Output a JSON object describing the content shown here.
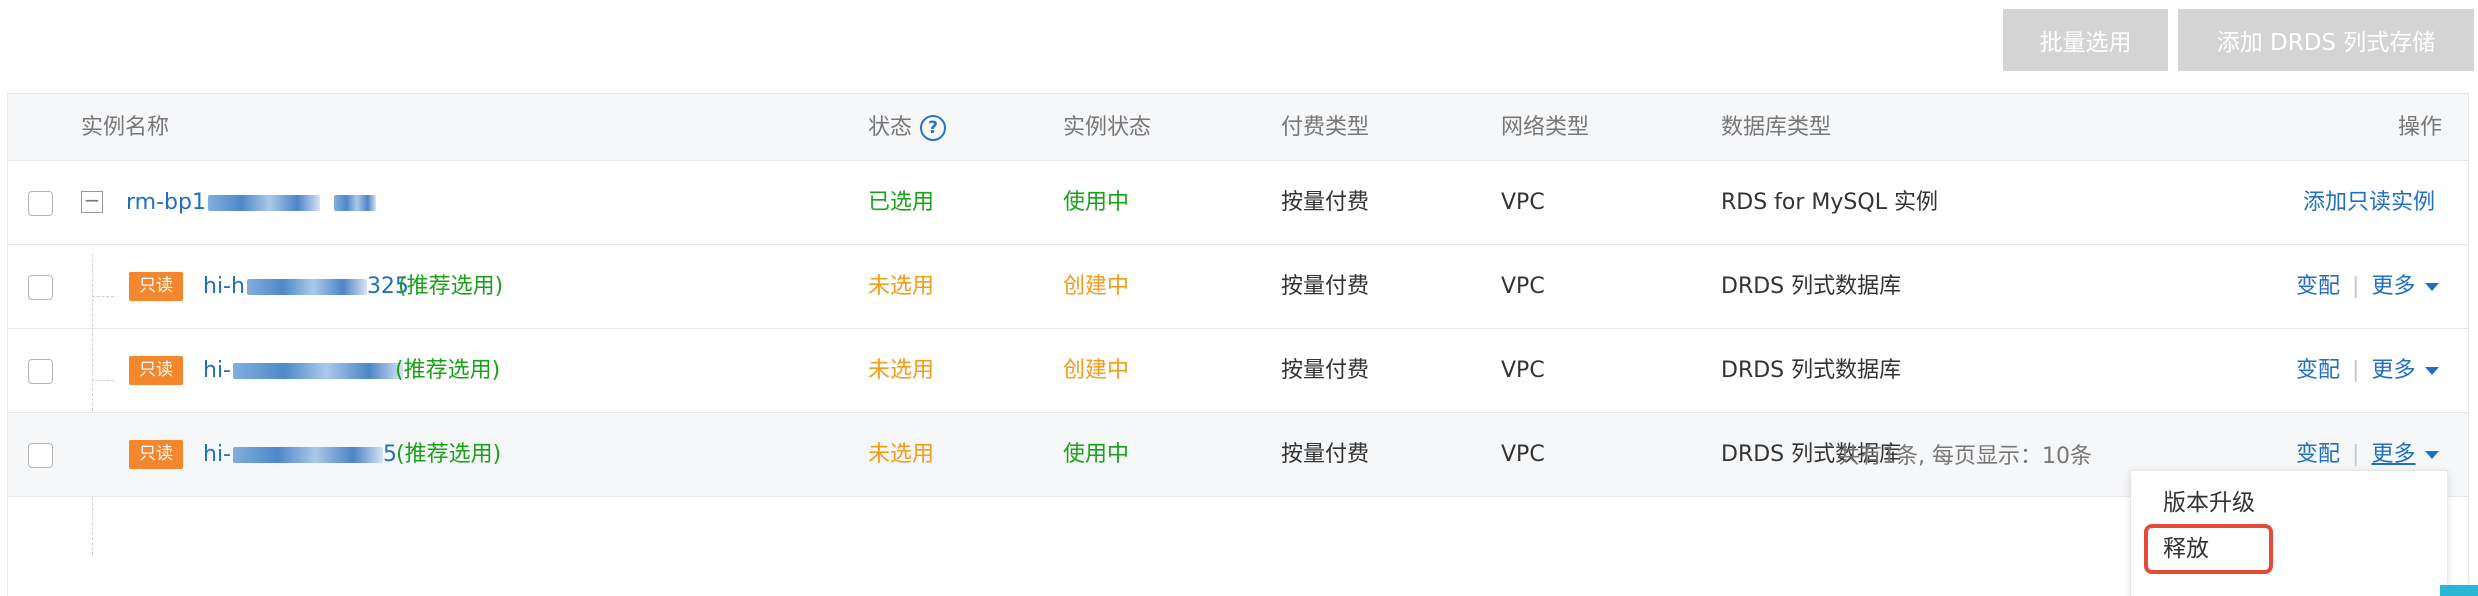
{
  "toolbar": {
    "batch_select_label": "批量选用",
    "add_drds_label": "添加 DRDS 列式存储"
  },
  "table": {
    "columns": {
      "name": "实例名称",
      "status": "状态",
      "instance_status": "实例状态",
      "billing": "付费类型",
      "network": "网络类型",
      "db_type": "数据库类型",
      "actions": "操作"
    },
    "help_icon": "question-circle-icon",
    "rows": [
      {
        "name": "rm-bp1",
        "status": "已选用",
        "instance_status": "使用中",
        "billing": "按量付费",
        "network": "VPC",
        "db_type": "RDS for MySQL 实例",
        "action": "添加只读实例"
      },
      {
        "badge": "只读",
        "name_prefix": "hi-h",
        "name_suffix": "325",
        "recommend": "(推荐选用)",
        "status": "未选用",
        "instance_status": "创建中",
        "billing": "按量付费",
        "network": "VPC",
        "db_type": "DRDS 列式数据库",
        "action_change": "变配",
        "action_more": "更多"
      },
      {
        "badge": "只读",
        "name_prefix": "hi-",
        "name_suffix": "",
        "recommend": "(推荐选用)",
        "status": "未选用",
        "instance_status": "创建中",
        "billing": "按量付费",
        "network": "VPC",
        "db_type": "DRDS 列式数据库",
        "action_change": "变配",
        "action_more": "更多"
      },
      {
        "badge": "只读",
        "name_prefix": "hi-",
        "name_suffix": "5",
        "recommend": "(推荐选用)",
        "status": "未选用",
        "instance_status": "使用中",
        "billing": "按量付费",
        "network": "VPC",
        "db_type": "DRDS 列式数据库",
        "action_change": "变配",
        "action_more": "更多"
      }
    ]
  },
  "pagination": {
    "text": "共有1条, 每页显示：10条"
  },
  "more_menu": {
    "items": [
      "版本升级",
      "释放"
    ]
  },
  "colors": {
    "link": "#1f6fc4",
    "green": "#1aa11a",
    "orange": "#f39b1a",
    "badge": "#f4872e",
    "highlight": "#e54b36"
  }
}
